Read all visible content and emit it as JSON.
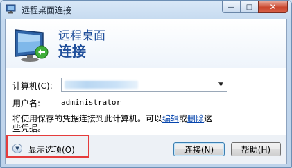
{
  "window": {
    "title": "远程桌面连接",
    "minimize_glyph": "—",
    "maximize_glyph": "□",
    "close_glyph": "✕"
  },
  "banner": {
    "line1": "远程桌面",
    "line2": "连接",
    "icon": "remote-desktop-icon"
  },
  "form": {
    "computer_label": "计算机(C):",
    "computer_value": "",
    "username_label": "用户名:",
    "username_value": "administrator",
    "note_before": "将使用保存的凭据连接到此计算机。可以",
    "edit_link": "编辑",
    "or": "或",
    "delete_link": "删除",
    "note_after": "这些凭据。"
  },
  "footer": {
    "show_options_label": "显示选项(O)",
    "connect_button": "连接(N)",
    "help_button": "帮助(H)"
  },
  "colors": {
    "accent_text": "#1f4e9a",
    "link": "#0645ad",
    "highlight_box": "#e53c3c"
  }
}
